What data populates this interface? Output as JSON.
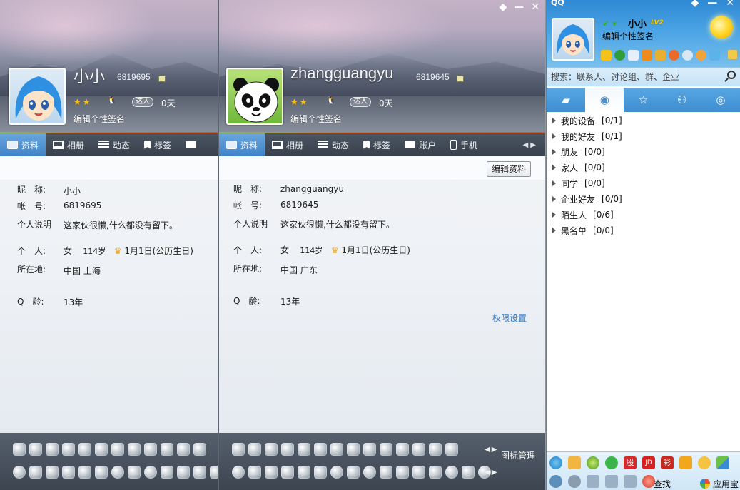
{
  "left_panel": {
    "nickname_display": "小小",
    "qq_number_display": "6819695",
    "stars": "★★",
    "daren_badge": "达人",
    "days": "0天",
    "signature": "编辑个性签名",
    "tabs": [
      {
        "label": "资料",
        "icon": "card"
      },
      {
        "label": "相册",
        "icon": "book"
      },
      {
        "label": "动态",
        "icon": "list"
      },
      {
        "label": "标签",
        "icon": "tag"
      }
    ],
    "fields": {
      "nick_label": "昵　称:",
      "nick_value": "小小",
      "account_label": "帐　号:",
      "account_value": "6819695",
      "desc_label": "个人说明",
      "desc_value": "这家伙很懒,什么都没有留下。",
      "person_label": "个　人:",
      "gender": "女",
      "age": "114岁",
      "birthday": "1月1日(公历生日)",
      "location_label": "所在地:",
      "location_value": "中国 上海",
      "qage_label": "Q　龄:",
      "qage_value": "13年"
    }
  },
  "right_panel": {
    "nickname_display": "zhangguangyu",
    "qq_number_display": "6819645",
    "stars": "★★",
    "daren_badge": "达人",
    "days": "0天",
    "signature": "编辑个性签名",
    "tabs": [
      {
        "label": "资料",
        "icon": "card"
      },
      {
        "label": "相册",
        "icon": "book"
      },
      {
        "label": "动态",
        "icon": "list"
      },
      {
        "label": "标签",
        "icon": "tag"
      },
      {
        "label": "账户",
        "icon": "bag"
      },
      {
        "label": "手机",
        "icon": "phone"
      }
    ],
    "edit_button": "编辑资料",
    "fields": {
      "nick_label": "昵　称:",
      "nick_value": "zhangguangyu",
      "account_label": "帐　号:",
      "account_value": "6819645",
      "desc_label": "个人说明",
      "desc_value": "这家伙很懒,什么都没有留下。",
      "person_label": "个　人:",
      "gender": "女",
      "age": "114岁",
      "birthday": "1月1日(公历生日)",
      "location_label": "所在地:",
      "location_value": "中国 广东",
      "qage_label": "Q　龄:",
      "qage_value": "13年"
    },
    "permission_link": "权限设置",
    "icon_manage": "图标管理"
  },
  "qq": {
    "title": "QQ",
    "nickname": "小小",
    "level_badge": "LV2",
    "signature": "编辑个性签名",
    "search_placeholder": "搜索：联系人、讨论组、群、企业",
    "groups": [
      {
        "name": "我的设备",
        "count": "[0/1]"
      },
      {
        "name": "我的好友",
        "count": "[0/1]"
      },
      {
        "name": "朋友",
        "count": "[0/0]"
      },
      {
        "name": "家人",
        "count": "[0/0]"
      },
      {
        "name": "同学",
        "count": "[0/0]"
      },
      {
        "name": "企业好友",
        "count": "[0/0]"
      },
      {
        "name": "陌生人",
        "count": "[0/6]"
      },
      {
        "name": "黑名单",
        "count": "[0/0]"
      }
    ],
    "find_label": "查找",
    "appbao_label": "应用宝",
    "colors": {
      "accent": "#3d8dd1",
      "online": "#36b31b"
    }
  }
}
